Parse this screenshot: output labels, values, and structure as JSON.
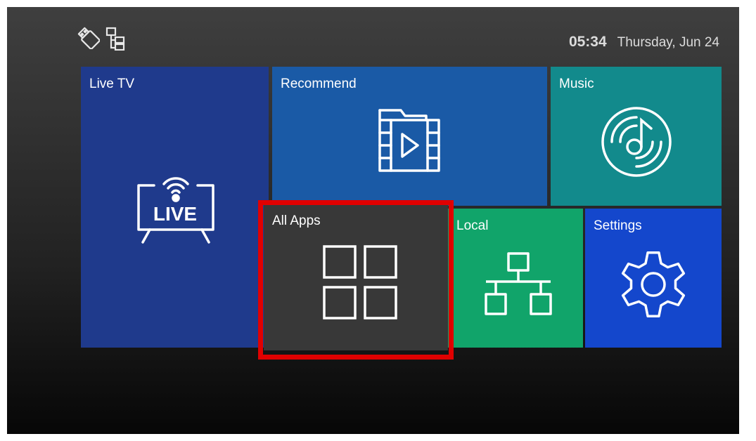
{
  "status": {
    "icons": [
      "usb-icon",
      "network-icon"
    ],
    "time": "05:34",
    "date": "Thursday, Jun 24"
  },
  "tiles": {
    "live_tv": {
      "label": "Live TV",
      "icon": "live-tv-icon",
      "icon_text": "LIVE",
      "color": "#1f3a8c"
    },
    "recommend": {
      "label": "Recommend",
      "icon": "video-folder-icon",
      "color": "#1a5aa6"
    },
    "music": {
      "label": "Music",
      "icon": "music-disc-icon",
      "color": "#128a8c"
    },
    "all_apps": {
      "label": "All Apps",
      "icon": "apps-grid-icon",
      "color": "#383838"
    },
    "local": {
      "label": "Local",
      "icon": "network-tree-icon",
      "color": "#11a46a"
    },
    "settings": {
      "label": "Settings",
      "icon": "gear-icon",
      "color": "#1447cc"
    }
  },
  "focus": {
    "selected_tile": "all_apps",
    "highlight_color": "#e00000"
  }
}
